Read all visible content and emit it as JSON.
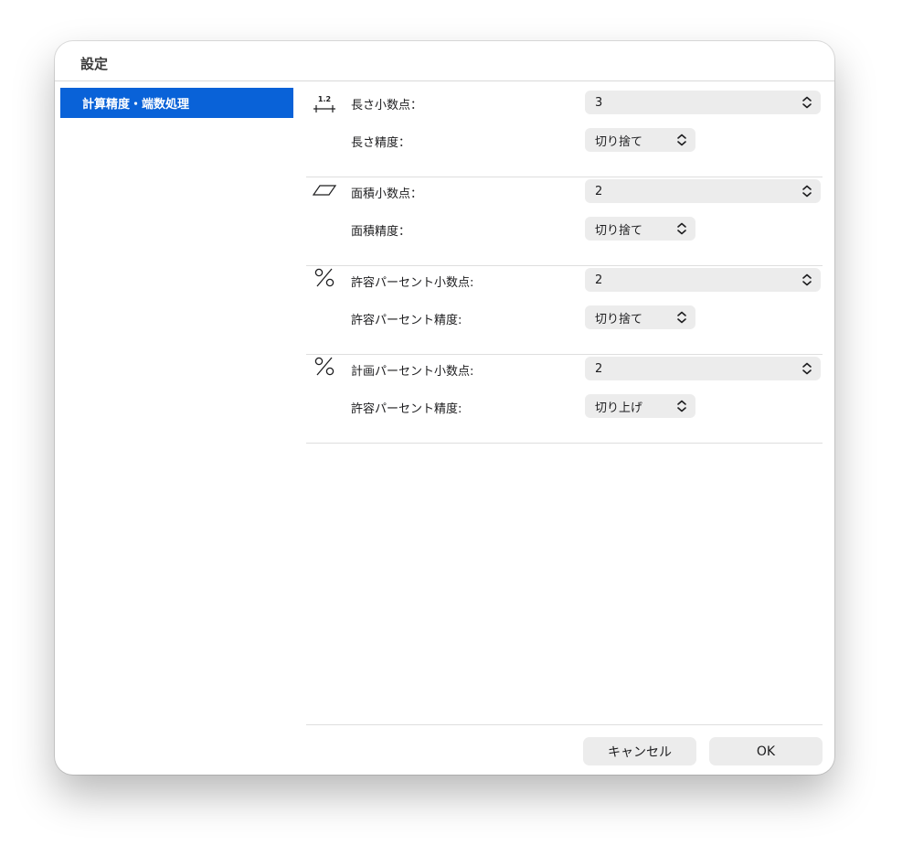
{
  "window": {
    "title": "設定"
  },
  "sidebar": {
    "items": [
      {
        "label": "計算精度・端数処理",
        "selected": true
      }
    ]
  },
  "groups": [
    {
      "icon": "length-ruler-icon",
      "rows": [
        {
          "label": "長さ小数点：",
          "value": "3"
        },
        {
          "label": "長さ精度：",
          "value": "切り捨て"
        }
      ]
    },
    {
      "icon": "parallelogram-area-icon",
      "rows": [
        {
          "label": "面積小数点：",
          "value": "2"
        },
        {
          "label": "面積精度：",
          "value": "切り捨て"
        }
      ]
    },
    {
      "icon": "percent-icon",
      "rows": [
        {
          "label": "許容パーセント小数点:",
          "value": "2"
        },
        {
          "label": "許容パーセント精度:",
          "value": "切り捨て"
        }
      ]
    },
    {
      "icon": "percent-icon",
      "rows": [
        {
          "label": "計画パーセント小数点:",
          "value": "2"
        },
        {
          "label": "許容パーセント精度:",
          "value": "切り上げ"
        }
      ]
    }
  ],
  "icon_labels": {
    "ruler": "1.2"
  },
  "buttons": {
    "cancel": "キャンセル",
    "ok": "OK"
  },
  "colors": {
    "accent": "#0962d8",
    "control_bg": "#ececec"
  }
}
